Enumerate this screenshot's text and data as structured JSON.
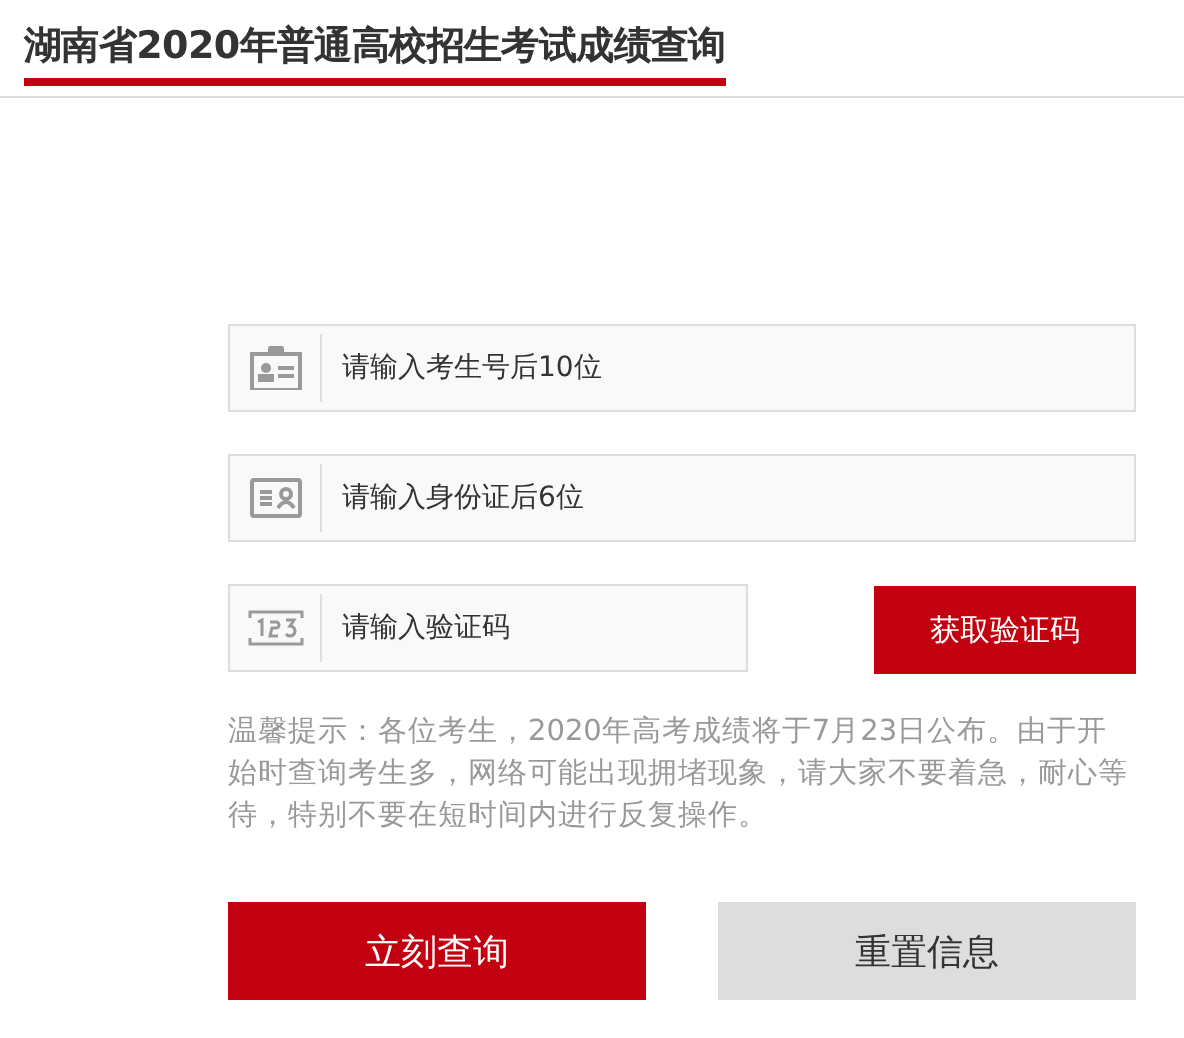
{
  "header": {
    "title": "湖南省2020年普通高校招生考试成绩查询"
  },
  "fields": [
    {
      "kind": "badge",
      "placeholder": "请输入考生号后10位"
    },
    {
      "kind": "idcard",
      "placeholder": "请输入身份证后6位"
    },
    {
      "kind": "code",
      "placeholder": "请输入验证码",
      "button": "获取验证码"
    }
  ],
  "notice": "温馨提示：各位考生，2020年高考成绩将于7月23日公布。由于开始时查询考生多，网络可能出现拥堵现象，请大家不要着急，耐心等待，特别不要在短时间内进行反复操作。",
  "actions": [
    {
      "kind": "primary",
      "label": "立刻查询"
    },
    {
      "kind": "secondary",
      "label": "重置信息"
    }
  ]
}
